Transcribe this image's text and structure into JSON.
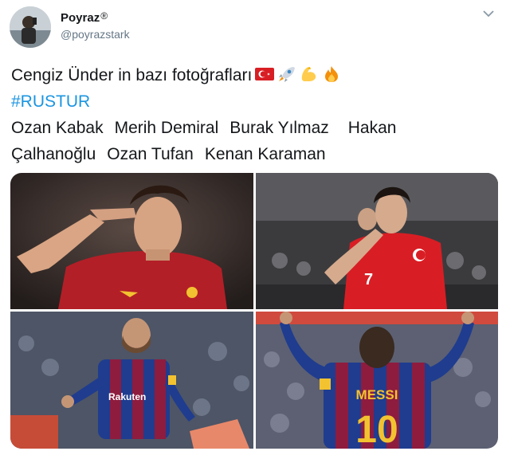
{
  "author": {
    "display_name": "Poyraz",
    "verified_mark": "®",
    "handle": "@poyrazstark",
    "avatar_icon": "user-avatar"
  },
  "menu_icon": "chevron-down-icon",
  "tweet": {
    "line1": "Cengiz Ünder in bazı fotoğrafları",
    "emojis": [
      "flag-turkey-icon",
      "rocket-icon",
      "flexed-biceps-icon",
      "fire-icon"
    ],
    "hashtag": "#RUSTUR",
    "names_line1": [
      "Ozan Kabak",
      "Merih Demiral",
      "Burak Yılmaz",
      "Hakan"
    ],
    "names_line2": [
      "Çalhanoğlu",
      "Ozan Tufan",
      "Kenan Karaman"
    ]
  },
  "photos": {
    "photo3_label": "Rakuten",
    "photo4_shirt_name": "MESSI",
    "photo4_shirt_number": "10",
    "photo2_shirt_number": "7"
  },
  "colors": {
    "hashtag": "#1b95e0",
    "roma_shirt": "#b31f27",
    "turkey_red": "#d81e24",
    "barca_blue": "#1f3c8f",
    "barca_garnet": "#8e1c3f",
    "gold": "#f2c230",
    "handle_gray": "#657786"
  }
}
